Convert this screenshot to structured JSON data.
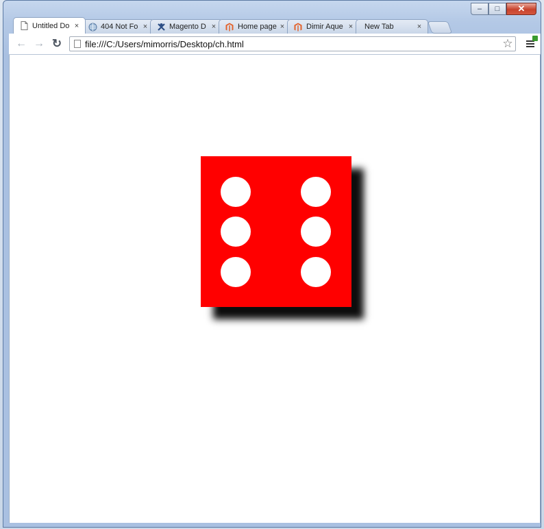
{
  "window": {
    "title": "",
    "controls": {
      "minimize": "–",
      "maximize": "□",
      "close": "✕"
    }
  },
  "tabs": [
    {
      "label": "Untitled Do",
      "icon": "document-icon",
      "active": true,
      "close": "×"
    },
    {
      "label": "404 Not Fo",
      "icon": "globe-icon",
      "active": false,
      "close": "×"
    },
    {
      "label": "Magento D",
      "icon": "magento-x-icon",
      "active": false,
      "close": "×"
    },
    {
      "label": "Home page",
      "icon": "magento-logo-icon",
      "active": false,
      "close": "×"
    },
    {
      "label": "Dimir Aque",
      "icon": "magento-logo-icon",
      "active": false,
      "close": "×"
    },
    {
      "label": "New Tab",
      "icon": "",
      "active": false,
      "close": "×"
    }
  ],
  "toolbar": {
    "back": "←",
    "forward": "→",
    "reload": "↻",
    "url": "file:///C:/Users/mimorris/Desktop/ch.html",
    "star": "☆"
  },
  "page": {
    "die": {
      "face_value": 6,
      "color": "#ff0000",
      "pip_color": "#ffffff",
      "shadow_color": "#000000"
    }
  },
  "colors": {
    "magento_orange": "#e3622b",
    "update_green": "#3a9b2e"
  }
}
